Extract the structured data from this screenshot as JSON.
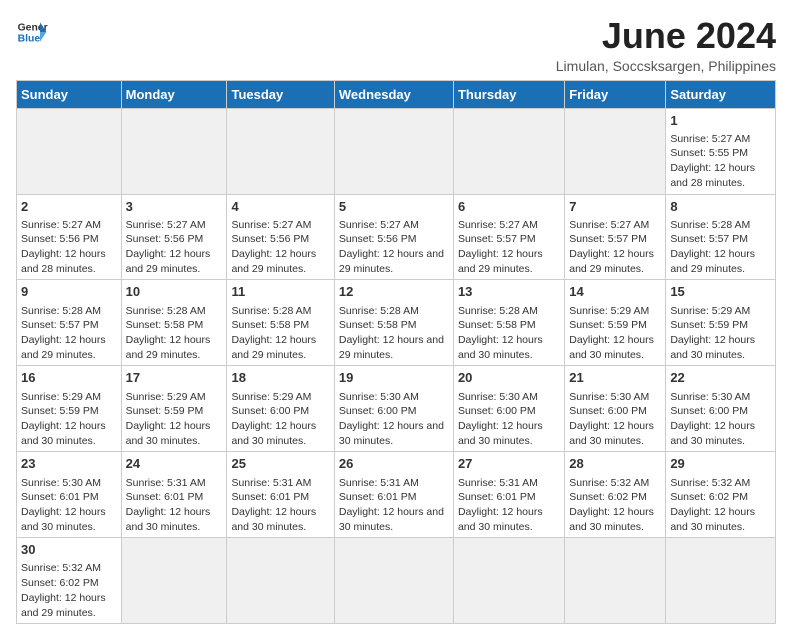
{
  "logo": {
    "line1": "General",
    "line2": "Blue"
  },
  "title": "June 2024",
  "subtitle": "Limulan, Soccsksargen, Philippines",
  "days_of_week": [
    "Sunday",
    "Monday",
    "Tuesday",
    "Wednesday",
    "Thursday",
    "Friday",
    "Saturday"
  ],
  "weeks": [
    [
      {
        "day": "",
        "empty": true
      },
      {
        "day": "",
        "empty": true
      },
      {
        "day": "",
        "empty": true
      },
      {
        "day": "",
        "empty": true
      },
      {
        "day": "",
        "empty": true
      },
      {
        "day": "",
        "empty": true
      },
      {
        "day": "1",
        "sunrise": "5:27 AM",
        "sunset": "5:55 PM",
        "daylight": "12 hours and 28 minutes."
      }
    ],
    [
      {
        "day": "2",
        "sunrise": "5:27 AM",
        "sunset": "5:56 PM",
        "daylight": "12 hours and 28 minutes."
      },
      {
        "day": "3",
        "sunrise": "5:27 AM",
        "sunset": "5:56 PM",
        "daylight": "12 hours and 29 minutes."
      },
      {
        "day": "4",
        "sunrise": "5:27 AM",
        "sunset": "5:56 PM",
        "daylight": "12 hours and 29 minutes."
      },
      {
        "day": "5",
        "sunrise": "5:27 AM",
        "sunset": "5:56 PM",
        "daylight": "12 hours and 29 minutes."
      },
      {
        "day": "6",
        "sunrise": "5:27 AM",
        "sunset": "5:57 PM",
        "daylight": "12 hours and 29 minutes."
      },
      {
        "day": "7",
        "sunrise": "5:27 AM",
        "sunset": "5:57 PM",
        "daylight": "12 hours and 29 minutes."
      },
      {
        "day": "8",
        "sunrise": "5:28 AM",
        "sunset": "5:57 PM",
        "daylight": "12 hours and 29 minutes."
      }
    ],
    [
      {
        "day": "9",
        "sunrise": "5:28 AM",
        "sunset": "5:57 PM",
        "daylight": "12 hours and 29 minutes."
      },
      {
        "day": "10",
        "sunrise": "5:28 AM",
        "sunset": "5:58 PM",
        "daylight": "12 hours and 29 minutes."
      },
      {
        "day": "11",
        "sunrise": "5:28 AM",
        "sunset": "5:58 PM",
        "daylight": "12 hours and 29 minutes."
      },
      {
        "day": "12",
        "sunrise": "5:28 AM",
        "sunset": "5:58 PM",
        "daylight": "12 hours and 29 minutes."
      },
      {
        "day": "13",
        "sunrise": "5:28 AM",
        "sunset": "5:58 PM",
        "daylight": "12 hours and 30 minutes."
      },
      {
        "day": "14",
        "sunrise": "5:29 AM",
        "sunset": "5:59 PM",
        "daylight": "12 hours and 30 minutes."
      },
      {
        "day": "15",
        "sunrise": "5:29 AM",
        "sunset": "5:59 PM",
        "daylight": "12 hours and 30 minutes."
      }
    ],
    [
      {
        "day": "16",
        "sunrise": "5:29 AM",
        "sunset": "5:59 PM",
        "daylight": "12 hours and 30 minutes."
      },
      {
        "day": "17",
        "sunrise": "5:29 AM",
        "sunset": "5:59 PM",
        "daylight": "12 hours and 30 minutes."
      },
      {
        "day": "18",
        "sunrise": "5:29 AM",
        "sunset": "6:00 PM",
        "daylight": "12 hours and 30 minutes."
      },
      {
        "day": "19",
        "sunrise": "5:30 AM",
        "sunset": "6:00 PM",
        "daylight": "12 hours and 30 minutes."
      },
      {
        "day": "20",
        "sunrise": "5:30 AM",
        "sunset": "6:00 PM",
        "daylight": "12 hours and 30 minutes."
      },
      {
        "day": "21",
        "sunrise": "5:30 AM",
        "sunset": "6:00 PM",
        "daylight": "12 hours and 30 minutes."
      },
      {
        "day": "22",
        "sunrise": "5:30 AM",
        "sunset": "6:00 PM",
        "daylight": "12 hours and 30 minutes."
      }
    ],
    [
      {
        "day": "23",
        "sunrise": "5:30 AM",
        "sunset": "6:01 PM",
        "daylight": "12 hours and 30 minutes."
      },
      {
        "day": "24",
        "sunrise": "5:31 AM",
        "sunset": "6:01 PM",
        "daylight": "12 hours and 30 minutes."
      },
      {
        "day": "25",
        "sunrise": "5:31 AM",
        "sunset": "6:01 PM",
        "daylight": "12 hours and 30 minutes."
      },
      {
        "day": "26",
        "sunrise": "5:31 AM",
        "sunset": "6:01 PM",
        "daylight": "12 hours and 30 minutes."
      },
      {
        "day": "27",
        "sunrise": "5:31 AM",
        "sunset": "6:01 PM",
        "daylight": "12 hours and 30 minutes."
      },
      {
        "day": "28",
        "sunrise": "5:32 AM",
        "sunset": "6:02 PM",
        "daylight": "12 hours and 30 minutes."
      },
      {
        "day": "29",
        "sunrise": "5:32 AM",
        "sunset": "6:02 PM",
        "daylight": "12 hours and 30 minutes."
      }
    ],
    [
      {
        "day": "30",
        "sunrise": "5:32 AM",
        "sunset": "6:02 PM",
        "daylight": "12 hours and 29 minutes."
      },
      {
        "day": "",
        "empty": true
      },
      {
        "day": "",
        "empty": true
      },
      {
        "day": "",
        "empty": true
      },
      {
        "day": "",
        "empty": true
      },
      {
        "day": "",
        "empty": true
      },
      {
        "day": "",
        "empty": true
      }
    ]
  ],
  "labels": {
    "sunrise": "Sunrise:",
    "sunset": "Sunset:",
    "daylight": "Daylight:"
  }
}
